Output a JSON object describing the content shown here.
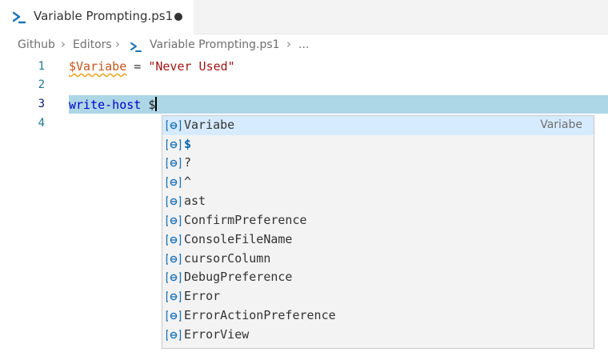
{
  "tab": {
    "title": "Variable Prompting.ps1",
    "icon": "powershell-icon",
    "dirty": true
  },
  "breadcrumb": {
    "items": [
      "Github",
      "Editors",
      "Variable Prompting.ps1",
      "..."
    ]
  },
  "editor": {
    "line_numbers": [
      "1",
      "2",
      "3",
      "4"
    ],
    "line1": {
      "variable": "$Variabe",
      "operator": "=",
      "string": "\"Never Used\""
    },
    "line3": {
      "command": "write-host",
      "dollar": "$"
    }
  },
  "suggest": {
    "items": [
      {
        "label": "Variabe",
        "detail": "Variabe"
      },
      {
        "label": "$"
      },
      {
        "label": "?"
      },
      {
        "label": "^"
      },
      {
        "label": "ast"
      },
      {
        "label": "ConfirmPreference"
      },
      {
        "label": "ConsoleFileName"
      },
      {
        "label": "cursorColumn"
      },
      {
        "label": "DebugPreference"
      },
      {
        "label": "Error"
      },
      {
        "label": "ErrorActionPreference"
      },
      {
        "label": "ErrorView"
      }
    ]
  },
  "colors": {
    "line_highlight": "#add6e6",
    "selected_suggestion": "#d6ebff",
    "line_number": "#237893",
    "suggest_icon": "#1c73b7"
  }
}
